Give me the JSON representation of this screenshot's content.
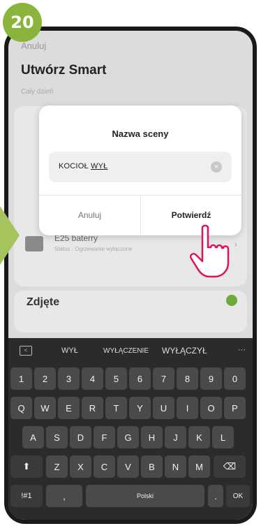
{
  "step_badge": "20",
  "header": {
    "cancel_label": "Anuluj",
    "title": "Utwórz Smart",
    "subtitle": "Cały dzień"
  },
  "device": {
    "name": "E25 baterry",
    "status": "Status : Ogrzewanie wyłączone"
  },
  "card2": {
    "title": "Zdjęte"
  },
  "dialog": {
    "title": "Nazwa sceny",
    "input_value_prefix": "KOCIOŁ ",
    "input_value_underlined": "WYŁ",
    "cancel_label": "Anuluj",
    "confirm_label": "Potwierdź"
  },
  "keyboard": {
    "suggestions": [
      "WYŁ",
      "WYŁĄCZENIE",
      "WYŁĄCZYŁ"
    ],
    "more_label": "···",
    "row_numbers": [
      "1",
      "2",
      "3",
      "4",
      "5",
      "6",
      "7",
      "8",
      "9",
      "0"
    ],
    "row1": [
      "Q",
      "W",
      "E",
      "R",
      "T",
      "Y",
      "U",
      "I",
      "O",
      "P"
    ],
    "row2": [
      "A",
      "S",
      "D",
      "F",
      "G",
      "H",
      "J",
      "K",
      "L"
    ],
    "row3": [
      "Z",
      "X",
      "C",
      "V",
      "B",
      "N",
      "M"
    ],
    "shift_label": "⬆",
    "backspace_label": "⌫",
    "symbols_label": "!#1",
    "comma_label": ",",
    "space_label": "Polski",
    "period_label": ".",
    "ok_label": "OK"
  },
  "colors": {
    "badge": "#8ab43a",
    "arrow": "#a6c45d",
    "hand_outline": "#e0115f"
  }
}
